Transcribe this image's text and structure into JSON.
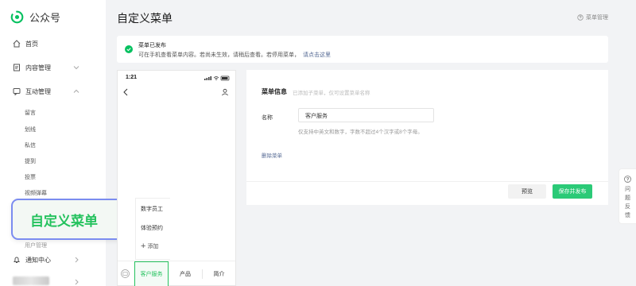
{
  "app": {
    "name": "公众号"
  },
  "sidebar": {
    "items": [
      {
        "label": "首页",
        "icon": "home-icon"
      },
      {
        "label": "内容管理",
        "icon": "document-icon"
      },
      {
        "label": "互动管理",
        "icon": "chat-icon"
      }
    ],
    "sub_items": [
      "留言",
      "划线",
      "私信",
      "提到",
      "投票",
      "视频弹幕"
    ],
    "hidden_item": "用户管理",
    "notification": "通知中心"
  },
  "callout": {
    "label": "自定义菜单"
  },
  "header": {
    "title": "自定义菜单",
    "manage_link": "菜单管理"
  },
  "notice": {
    "title": "菜单已发布",
    "text": "可在手机查看菜单内容。若尚未生效，请稍后查看。若停用菜单，",
    "link": "请点击这里"
  },
  "phone": {
    "time": "1:21",
    "popup": [
      "数字员工",
      "体验预约",
      "添加"
    ],
    "tabs": [
      "客户服务",
      "产品",
      "简介"
    ]
  },
  "editor": {
    "section_title": "菜单信息",
    "section_hint": "已添加子菜单，仅可设置菜单名称",
    "name_label": "名称",
    "name_value": "客户服务",
    "name_note": "仅支持中英文和数字，字数不超过4个汉字或8个字母。",
    "delete_label": "删除菜单"
  },
  "actions": {
    "preview": "预览",
    "publish": "保存并发布"
  },
  "feedback": {
    "chars": [
      "问",
      "题",
      "反",
      "馈"
    ]
  },
  "colors": {
    "accent": "#07c160",
    "link": "#576b95",
    "callout_border": "#7b8cf0"
  }
}
